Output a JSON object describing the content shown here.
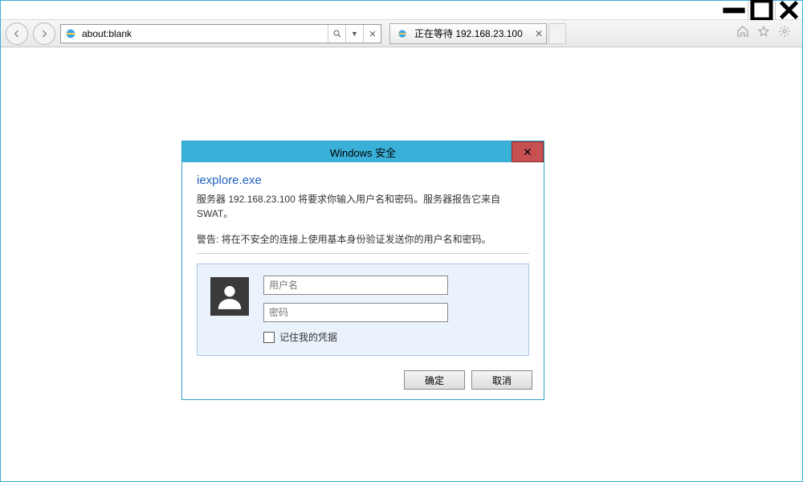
{
  "window": {
    "minimize": "—",
    "maximize": "◻",
    "close": "✕"
  },
  "nav": {
    "address": "about:blank"
  },
  "tab": {
    "label": "正在等待 192.168.23.100"
  },
  "dialog": {
    "title": "Windows 安全",
    "app": "iexplore.exe",
    "msg": "服务器 192.168.23.100 将要求你输入用户名和密码。服务器报告它来自 SWAT。",
    "warn": "警告: 将在不安全的连接上使用基本身份验证发送你的用户名和密码。",
    "username_placeholder": "用户名",
    "password_placeholder": "密码",
    "remember": "记住我的凭据",
    "ok": "确定",
    "cancel": "取消"
  }
}
